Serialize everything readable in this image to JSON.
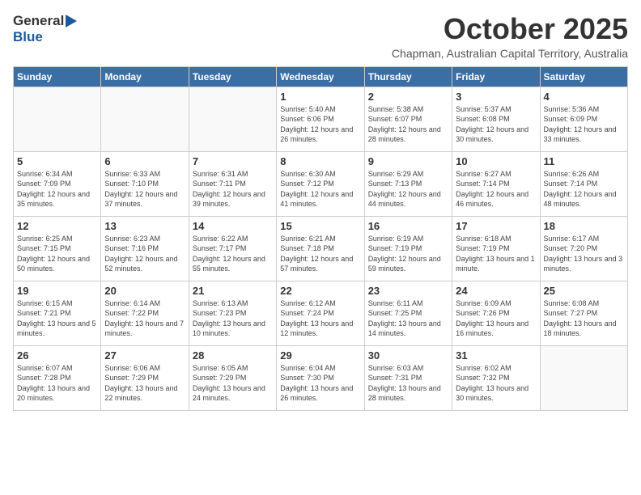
{
  "header": {
    "logo_general": "General",
    "logo_blue": "Blue",
    "month_year": "October 2025",
    "location": "Chapman, Australian Capital Territory, Australia"
  },
  "days_of_week": [
    "Sunday",
    "Monday",
    "Tuesday",
    "Wednesday",
    "Thursday",
    "Friday",
    "Saturday"
  ],
  "weeks": [
    [
      {
        "day": "",
        "info": ""
      },
      {
        "day": "",
        "info": ""
      },
      {
        "day": "",
        "info": ""
      },
      {
        "day": "1",
        "info": "Sunrise: 5:40 AM\nSunset: 6:06 PM\nDaylight: 12 hours\nand 26 minutes."
      },
      {
        "day": "2",
        "info": "Sunrise: 5:38 AM\nSunset: 6:07 PM\nDaylight: 12 hours\nand 28 minutes."
      },
      {
        "day": "3",
        "info": "Sunrise: 5:37 AM\nSunset: 6:08 PM\nDaylight: 12 hours\nand 30 minutes."
      },
      {
        "day": "4",
        "info": "Sunrise: 5:36 AM\nSunset: 6:09 PM\nDaylight: 12 hours\nand 33 minutes."
      }
    ],
    [
      {
        "day": "5",
        "info": "Sunrise: 6:34 AM\nSunset: 7:09 PM\nDaylight: 12 hours\nand 35 minutes."
      },
      {
        "day": "6",
        "info": "Sunrise: 6:33 AM\nSunset: 7:10 PM\nDaylight: 12 hours\nand 37 minutes."
      },
      {
        "day": "7",
        "info": "Sunrise: 6:31 AM\nSunset: 7:11 PM\nDaylight: 12 hours\nand 39 minutes."
      },
      {
        "day": "8",
        "info": "Sunrise: 6:30 AM\nSunset: 7:12 PM\nDaylight: 12 hours\nand 41 minutes."
      },
      {
        "day": "9",
        "info": "Sunrise: 6:29 AM\nSunset: 7:13 PM\nDaylight: 12 hours\nand 44 minutes."
      },
      {
        "day": "10",
        "info": "Sunrise: 6:27 AM\nSunset: 7:14 PM\nDaylight: 12 hours\nand 46 minutes."
      },
      {
        "day": "11",
        "info": "Sunrise: 6:26 AM\nSunset: 7:14 PM\nDaylight: 12 hours\nand 48 minutes."
      }
    ],
    [
      {
        "day": "12",
        "info": "Sunrise: 6:25 AM\nSunset: 7:15 PM\nDaylight: 12 hours\nand 50 minutes."
      },
      {
        "day": "13",
        "info": "Sunrise: 6:23 AM\nSunset: 7:16 PM\nDaylight: 12 hours\nand 52 minutes."
      },
      {
        "day": "14",
        "info": "Sunrise: 6:22 AM\nSunset: 7:17 PM\nDaylight: 12 hours\nand 55 minutes."
      },
      {
        "day": "15",
        "info": "Sunrise: 6:21 AM\nSunset: 7:18 PM\nDaylight: 12 hours\nand 57 minutes."
      },
      {
        "day": "16",
        "info": "Sunrise: 6:19 AM\nSunset: 7:19 PM\nDaylight: 12 hours\nand 59 minutes."
      },
      {
        "day": "17",
        "info": "Sunrise: 6:18 AM\nSunset: 7:19 PM\nDaylight: 13 hours\nand 1 minute."
      },
      {
        "day": "18",
        "info": "Sunrise: 6:17 AM\nSunset: 7:20 PM\nDaylight: 13 hours\nand 3 minutes."
      }
    ],
    [
      {
        "day": "19",
        "info": "Sunrise: 6:15 AM\nSunset: 7:21 PM\nDaylight: 13 hours\nand 5 minutes."
      },
      {
        "day": "20",
        "info": "Sunrise: 6:14 AM\nSunset: 7:22 PM\nDaylight: 13 hours\nand 7 minutes."
      },
      {
        "day": "21",
        "info": "Sunrise: 6:13 AM\nSunset: 7:23 PM\nDaylight: 13 hours\nand 10 minutes."
      },
      {
        "day": "22",
        "info": "Sunrise: 6:12 AM\nSunset: 7:24 PM\nDaylight: 13 hours\nand 12 minutes."
      },
      {
        "day": "23",
        "info": "Sunrise: 6:11 AM\nSunset: 7:25 PM\nDaylight: 13 hours\nand 14 minutes."
      },
      {
        "day": "24",
        "info": "Sunrise: 6:09 AM\nSunset: 7:26 PM\nDaylight: 13 hours\nand 16 minutes."
      },
      {
        "day": "25",
        "info": "Sunrise: 6:08 AM\nSunset: 7:27 PM\nDaylight: 13 hours\nand 18 minutes."
      }
    ],
    [
      {
        "day": "26",
        "info": "Sunrise: 6:07 AM\nSunset: 7:28 PM\nDaylight: 13 hours\nand 20 minutes."
      },
      {
        "day": "27",
        "info": "Sunrise: 6:06 AM\nSunset: 7:29 PM\nDaylight: 13 hours\nand 22 minutes."
      },
      {
        "day": "28",
        "info": "Sunrise: 6:05 AM\nSunset: 7:29 PM\nDaylight: 13 hours\nand 24 minutes."
      },
      {
        "day": "29",
        "info": "Sunrise: 6:04 AM\nSunset: 7:30 PM\nDaylight: 13 hours\nand 26 minutes."
      },
      {
        "day": "30",
        "info": "Sunrise: 6:03 AM\nSunset: 7:31 PM\nDaylight: 13 hours\nand 28 minutes."
      },
      {
        "day": "31",
        "info": "Sunrise: 6:02 AM\nSunset: 7:32 PM\nDaylight: 13 hours\nand 30 minutes."
      },
      {
        "day": "",
        "info": ""
      }
    ]
  ]
}
